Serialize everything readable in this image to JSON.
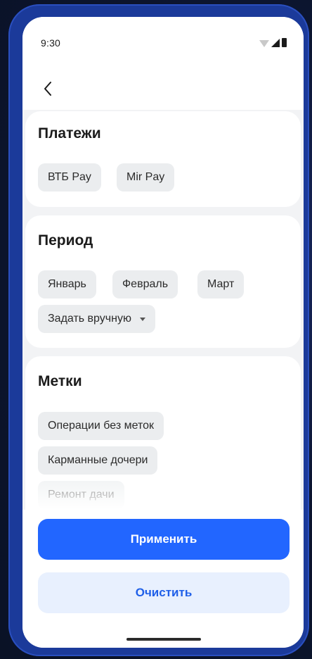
{
  "status_bar": {
    "time": "9:30",
    "icons": [
      "wifi-icon",
      "signal-icon",
      "battery-icon"
    ]
  },
  "nav": {
    "back_icon": "chevron-left-icon"
  },
  "payments": {
    "title": "Платежи",
    "chips": [
      "ВТБ Pay",
      "Mir Pay"
    ]
  },
  "period": {
    "title": "Период",
    "chips": [
      "Январь",
      "Февраль",
      "Март"
    ],
    "custom": "Задать вручную",
    "custom_icon": "caret-down-icon"
  },
  "tags": {
    "title": "Метки",
    "chips": [
      "Операции без меток",
      "Карманные дочери",
      "Ремонт дачи"
    ]
  },
  "actions": {
    "apply": "Применить",
    "clear": "Очистить"
  },
  "colors": {
    "accent": "#2266ff",
    "secondary_bg": "#e8f0fe",
    "chip_bg": "#ebedef",
    "frame": "#1b3a9a"
  }
}
